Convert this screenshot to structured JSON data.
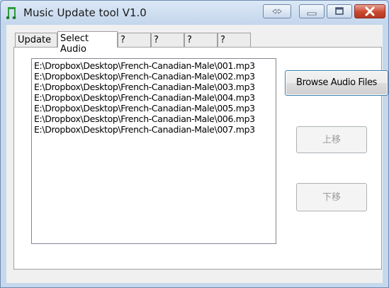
{
  "window": {
    "title": "Music Update tool V1.0",
    "icon": "music-notes-icon"
  },
  "tabs": [
    {
      "label": "Update",
      "active": false
    },
    {
      "label": "Select Audio",
      "active": true
    },
    {
      "label": "?",
      "active": false
    },
    {
      "label": "?",
      "active": false
    },
    {
      "label": "?",
      "active": false
    },
    {
      "label": "?",
      "active": false
    }
  ],
  "audio_files": [
    "E:\\Dropbox\\Desktop\\French-Canadian-Male\\001.mp3",
    "E:\\Dropbox\\Desktop\\French-Canadian-Male\\002.mp3",
    "E:\\Dropbox\\Desktop\\French-Canadian-Male\\003.mp3",
    "E:\\Dropbox\\Desktop\\French-Canadian-Male\\004.mp3",
    "E:\\Dropbox\\Desktop\\French-Canadian-Male\\005.mp3",
    "E:\\Dropbox\\Desktop\\French-Canadian-Male\\006.mp3",
    "E:\\Dropbox\\Desktop\\French-Canadian-Male\\007.mp3"
  ],
  "buttons": {
    "browse": "Browse Audio Files",
    "move_up": "上移",
    "move_down": "下移"
  },
  "colors": {
    "close_button": "#c9482f",
    "focus_border": "#3c7fb1"
  }
}
